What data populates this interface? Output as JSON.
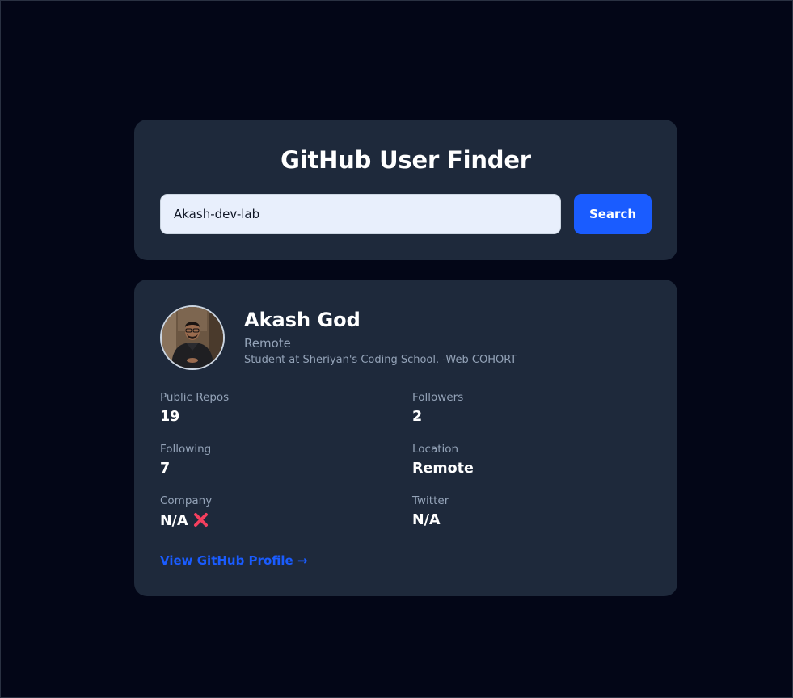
{
  "app": {
    "title": "GitHub User Finder"
  },
  "search": {
    "value": "Akash-dev-lab",
    "button_label": "Search"
  },
  "profile": {
    "name": "Akash God",
    "location": "Remote",
    "bio": "Student at Sheriyan's Coding School. -Web COHORT",
    "stats": {
      "public_repos": {
        "label": "Public Repos",
        "value": "19"
      },
      "followers": {
        "label": "Followers",
        "value": "2"
      },
      "following": {
        "label": "Following",
        "value": "7"
      },
      "location": {
        "label": "Location",
        "value": "Remote"
      },
      "company": {
        "label": "Company",
        "value": "N/A"
      },
      "twitter": {
        "label": "Twitter",
        "value": "N/A"
      }
    },
    "link_label": "View GitHub Profile →"
  },
  "colors": {
    "background": "#030617",
    "card": "#1e293b",
    "accent": "#1a5cff",
    "muted_text": "#94a3b8",
    "cross": "#f43f5e"
  },
  "icons": {
    "company_status": "cross-mark-icon"
  }
}
